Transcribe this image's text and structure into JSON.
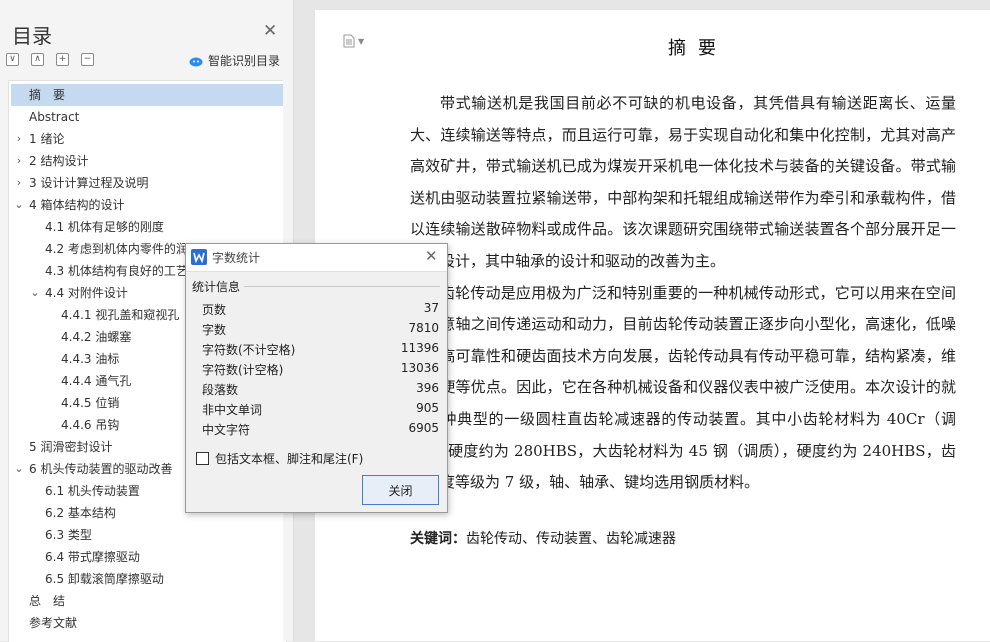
{
  "sidebar": {
    "title": "目录",
    "tools": [
      "∨",
      "∧",
      "+",
      "−"
    ],
    "smart_label": "智能识别目录",
    "items": [
      {
        "label": "摘　要",
        "level": 0,
        "arrow": "",
        "selected": true
      },
      {
        "label": "Abstract",
        "level": 0,
        "arrow": ""
      },
      {
        "label": "1  绪论",
        "level": 0,
        "arrow": "›"
      },
      {
        "label": "2 结构设计",
        "level": 0,
        "arrow": "›"
      },
      {
        "label": "3  设计计算过程及说明",
        "level": 0,
        "arrow": "›"
      },
      {
        "label": "4 箱体结构的设计",
        "level": 0,
        "arrow": "⌄"
      },
      {
        "label": "4.1  机体有足够的刚度",
        "level": 1,
        "arrow": ""
      },
      {
        "label": "4.2  考虑到机体内零件的润",
        "level": 1,
        "arrow": ""
      },
      {
        "label": "4.3 机体结构有良好的工艺",
        "level": 1,
        "arrow": ""
      },
      {
        "label": "4.4 对附件设计",
        "level": 1,
        "arrow": "⌄"
      },
      {
        "label": "4.4.1 视孔盖和窥视孔",
        "level": 2,
        "arrow": ""
      },
      {
        "label": "4.4.2  油螺塞",
        "level": 2,
        "arrow": ""
      },
      {
        "label": "4.4.3 油标",
        "level": 2,
        "arrow": ""
      },
      {
        "label": "4.4.4  通气孔",
        "level": 2,
        "arrow": ""
      },
      {
        "label": "4.4.5 位销",
        "level": 2,
        "arrow": ""
      },
      {
        "label": "4.4.6  吊钩",
        "level": 2,
        "arrow": ""
      },
      {
        "label": "5  润滑密封设计",
        "level": 0,
        "arrow": ""
      },
      {
        "label": "6 机头传动装置的驱动改善",
        "level": 0,
        "arrow": "⌄"
      },
      {
        "label": "6.1 机头传动装置",
        "level": 1,
        "arrow": ""
      },
      {
        "label": "6.2 基本结构",
        "level": 1,
        "arrow": ""
      },
      {
        "label": "6.3 类型",
        "level": 1,
        "arrow": ""
      },
      {
        "label": "6.4 带式摩擦驱动",
        "level": 1,
        "arrow": ""
      },
      {
        "label": "6.5 卸载滚筒摩擦驱动",
        "level": 1,
        "arrow": ""
      },
      {
        "label": "总　结",
        "level": 0,
        "arrow": ""
      },
      {
        "label": "参考文献",
        "level": 0,
        "arrow": ""
      }
    ]
  },
  "document": {
    "heading": "摘要",
    "paragraphs": [
      "带式输送机是我国目前必不可缺的机电设备，其凭借具有输送距离长、运量大、连续输送等特点，而且运行可靠，易于实现自动化和集中化控制，尤其对高产高效矿井，带式输送机已成为煤炭开采机电一体化技术与装备的关键设备。带式输送机由驱动装置拉紧输送带，中部构架和托辊组成输送带作为牵引和承载构件，借以连续输送散碎物料或成件品。该次课题研究围绕带式输送装置各个部分展开足一攻破设计，其中轴承的设计和驱动的改善为主。",
      "齿轮传动是应用极为广泛和特别重要的一种机械传动形式，它可以用来在空间的任意轴之间传递运动和动力，目前齿轮传动装置正逐步向小型化，高速化，低噪声，高可靠性和硬齿面技术方向发展，齿轮传动具有传动平稳可靠，结构紧凑，维护方便等优点。因此，它在各种机械设备和仪器仪表中被广泛使用。本次设计的就是一种典型的一级圆柱直齿轮减速器的传动装置。其中小齿轮材料为 40Cr（调质），硬度约为 280HBS，大齿轮材料为 45 钢（调质），硬度约为 240HBS，齿轮精度等级为 7 级，轴、轴承、键均选用钢质材料。"
    ],
    "keywords_label": "关键词：",
    "keywords": "齿轮传动、传动装置、齿轮减速器"
  },
  "dialog": {
    "title": "字数统计",
    "group_label": "统计信息",
    "stats": [
      {
        "label": "页数",
        "value": "37"
      },
      {
        "label": "字数",
        "value": "7810"
      },
      {
        "label": "字符数(不计空格)",
        "value": "11396"
      },
      {
        "label": "字符数(计空格)",
        "value": "13036"
      },
      {
        "label": "段落数",
        "value": "396"
      },
      {
        "label": "非中文单词",
        "value": "905"
      },
      {
        "label": "中文字符",
        "value": "6905"
      }
    ],
    "checkbox_label": "包括文本框、脚注和尾注(F)",
    "checkbox_checked": false,
    "close_button": "关闭"
  },
  "colors": {
    "accent": "#2b6fd6",
    "selection": "#c5d9f1"
  }
}
